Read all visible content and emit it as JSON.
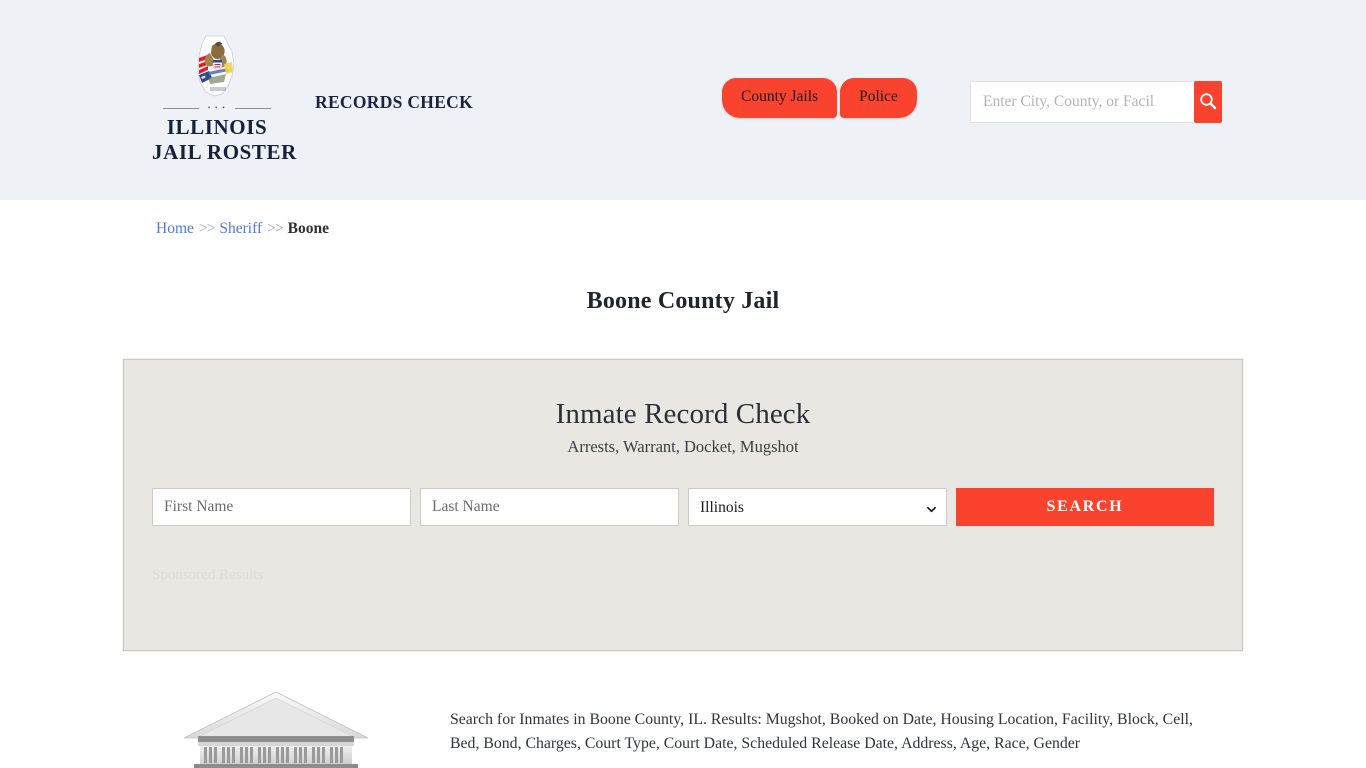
{
  "header": {
    "brand": {
      "crest_icon": "illinois-state-crest-icon",
      "divider_dots": "• • •",
      "line1": "ILLINOIS",
      "line2": "JAIL ROSTER"
    },
    "tagline": "RECORDS CHECK",
    "nav": [
      {
        "label": "County Jails",
        "name": "nav-tab-county-jails"
      },
      {
        "label": "Police",
        "name": "nav-tab-police"
      }
    ],
    "search": {
      "placeholder": "Enter City, County, or Facil",
      "value": "",
      "button_icon": "search-icon"
    },
    "background_color": "#eef2f7",
    "accent_color": "#f9432f"
  },
  "breadcrumb": {
    "items": [
      {
        "label": "Home",
        "type": "link"
      },
      {
        "label": "Sheriff",
        "type": "link"
      },
      {
        "label": "Boone",
        "type": "current"
      }
    ],
    "separator": ">>",
    "link_color": "#5577dd"
  },
  "page_title": "Boone County Jail",
  "record_check": {
    "heading": "Inmate Record Check",
    "subheading": "Arrests, Warrant, Docket, Mugshot",
    "first_name": {
      "placeholder": "First Name",
      "value": ""
    },
    "last_name": {
      "placeholder": "Last Name",
      "value": ""
    },
    "state": {
      "selected": "Illinois",
      "chevron_icon": "chevron-down-icon"
    },
    "submit_label": "SEARCH",
    "sponsored_label": "Sponsored Results",
    "card_background": "#e8e7e1"
  },
  "description": {
    "image_icon": "courthouse-building-icon",
    "text": "Search for Inmates in Boone County, IL. Results: Mugshot, Booked on Date, Housing Location, Facility, Block, Cell, Bed, Bond, Charges, Court Type, Court Date, Scheduled Release Date, Address, Age, Race, Gender"
  }
}
